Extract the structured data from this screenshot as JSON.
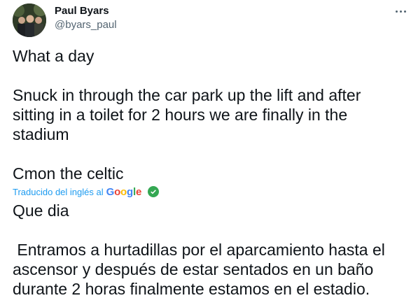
{
  "user": {
    "name": "Paul Byars",
    "handle": "@byars_paul"
  },
  "tweet": {
    "text": "What a day\n\nSnuck in through the car park up the lift and after\nsitting in a toilet for 2 hours we are finally in the\nstadium\n\nCmon the celtic"
  },
  "translation": {
    "label": "Traducido del inglés al",
    "provider": "Google",
    "text": "Que dia\n\n Entramos a hurtadillas por el aparcamiento hasta el\nascensor y después de estar sentados en un baño\ndurante 2 horas finalmente estamos en el estadio."
  },
  "icons": {
    "more": "more-options-icon",
    "verified": "check-circle-icon"
  },
  "colors": {
    "link": "#1d9bf0",
    "secondary": "#536471",
    "check": "#34a853"
  }
}
